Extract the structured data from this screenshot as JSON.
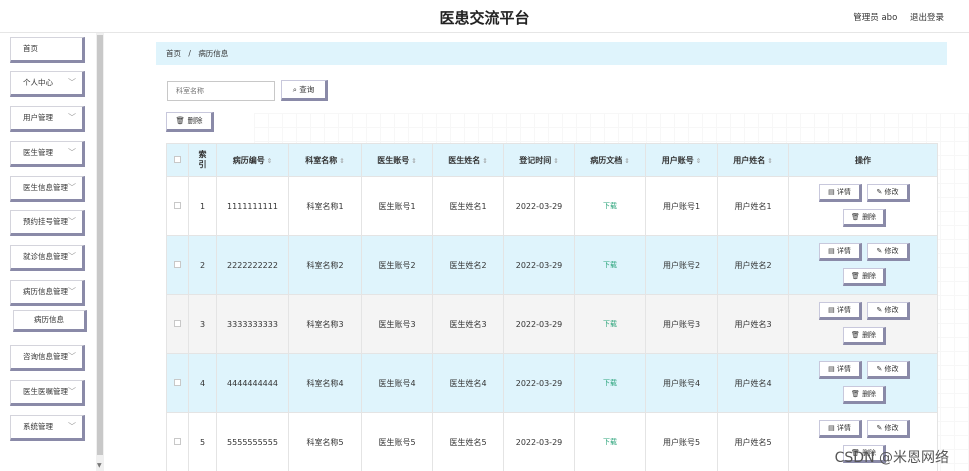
{
  "header": {
    "title": "医患交流平台",
    "user_label": "管理员 abo",
    "logout_label": "退出登录"
  },
  "sidebar": {
    "items": [
      {
        "label": "首页",
        "has_chevron": false
      },
      {
        "label": "个人中心",
        "has_chevron": true
      },
      {
        "label": "用户管理",
        "has_chevron": true
      },
      {
        "label": "医生管理",
        "has_chevron": true
      },
      {
        "label": "医生信息管理",
        "has_chevron": true
      },
      {
        "label": "预约挂号管理",
        "has_chevron": true
      },
      {
        "label": "就诊信息管理",
        "has_chevron": true
      },
      {
        "label": "病历信息管理",
        "has_chevron": true
      },
      {
        "label": "病历信息",
        "has_chevron": false,
        "sub": true
      },
      {
        "label": "咨询信息管理",
        "has_chevron": true
      },
      {
        "label": "医生医嘱管理",
        "has_chevron": true
      },
      {
        "label": "系统管理",
        "has_chevron": true
      }
    ],
    "chevron": "﹀"
  },
  "breadcrumb": {
    "home": "首页",
    "separator": "/",
    "current": "病历信息"
  },
  "search": {
    "placeholder": "科室名称",
    "query_label": "查询",
    "delete_label": "删除"
  },
  "table": {
    "headers": {
      "index": "索引",
      "record_no": "病历编号",
      "dept": "科室名称",
      "doctor_account": "医生账号",
      "doctor_name": "医生姓名",
      "reg_time": "登记时间",
      "doc": "病历文档",
      "user_account": "用户账号",
      "user_name": "用户姓名",
      "actions": "操作"
    },
    "sort_glyph": "⇕",
    "actions": {
      "detail": "详情",
      "edit": "修改",
      "delete": "删除"
    },
    "rows": [
      {
        "index": "1",
        "record_no": "1111111111",
        "dept": "科室名称1",
        "doctor_account": "医生账号1",
        "doctor_name": "医生姓名1",
        "reg_time": "2022-03-29",
        "doc": "下载",
        "user_account": "用户账号1",
        "user_name": "用户姓名1"
      },
      {
        "index": "2",
        "record_no": "2222222222",
        "dept": "科室名称2",
        "doctor_account": "医生账号2",
        "doctor_name": "医生姓名2",
        "reg_time": "2022-03-29",
        "doc": "下载",
        "user_account": "用户账号2",
        "user_name": "用户姓名2"
      },
      {
        "index": "3",
        "record_no": "3333333333",
        "dept": "科室名称3",
        "doctor_account": "医生账号3",
        "doctor_name": "医生姓名3",
        "reg_time": "2022-03-29",
        "doc": "下载",
        "user_account": "用户账号3",
        "user_name": "用户姓名3"
      },
      {
        "index": "4",
        "record_no": "4444444444",
        "dept": "科室名称4",
        "doctor_account": "医生账号4",
        "doctor_name": "医生姓名4",
        "reg_time": "2022-03-29",
        "doc": "下载",
        "user_account": "用户账号4",
        "user_name": "用户姓名4"
      },
      {
        "index": "5",
        "record_no": "5555555555",
        "dept": "科室名称5",
        "doctor_account": "医生账号5",
        "doctor_name": "医生姓名5",
        "reg_time": "2022-03-29",
        "doc": "下载",
        "user_account": "用户账号5",
        "user_name": "用户姓名5"
      }
    ]
  },
  "watermark": "CSDN @米恩网络",
  "colors": {
    "accent_bg": "#dff4fc",
    "button_shadow": "#8a8aa8",
    "download_link": "#2aa37a"
  }
}
